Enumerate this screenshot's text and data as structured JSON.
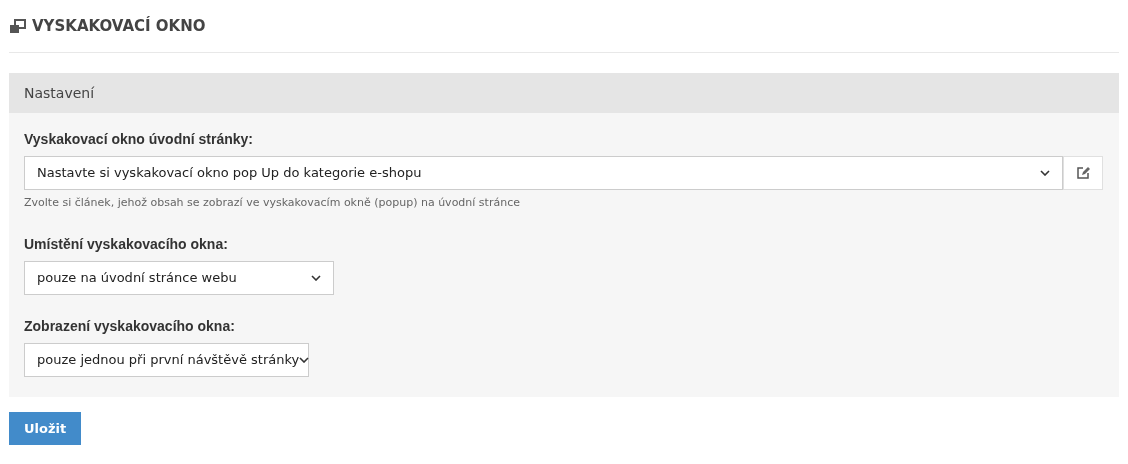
{
  "page": {
    "title": "VYSKAKOVACÍ OKNO"
  },
  "panel": {
    "title": "Nastavení",
    "fields": [
      {
        "kind": "select_edit",
        "label": "Vyskakovací okno úvodní stránky:",
        "value": "Nastavte si vyskakovací okno pop Up do kategorie e-shopu",
        "help": "Zvolte si článek, jehož obsah se zobrazí ve vyskakovacím okně (popup) na úvodní stránce"
      },
      {
        "kind": "select",
        "label": "Umístění vyskakovacího okna:",
        "value": "pouze na úvodní stránce webu"
      },
      {
        "kind": "select",
        "label": "Zobrazení vyskakovacího okna:",
        "value": "pouze jednou při první návštěvě stránky"
      }
    ]
  },
  "buttons": [
    "Uložit"
  ]
}
